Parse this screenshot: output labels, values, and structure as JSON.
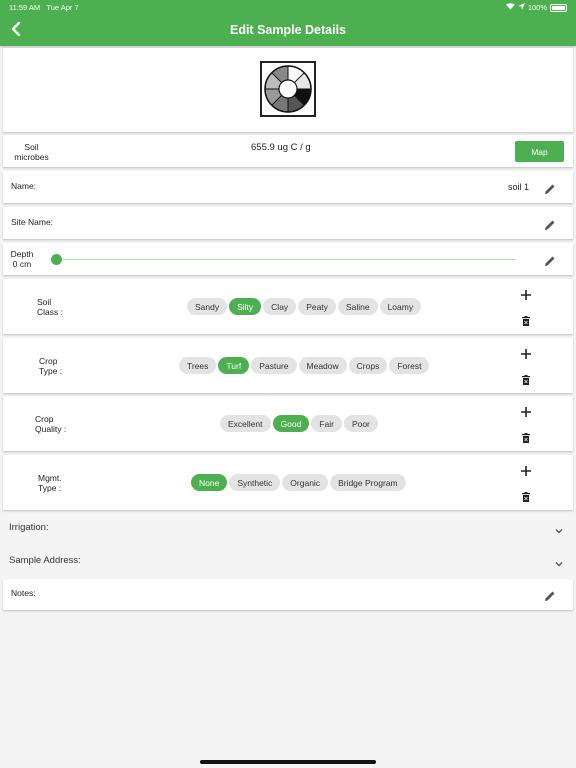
{
  "status_bar": {
    "time": "11:59 AM",
    "date": "Tue Apr 7",
    "battery": "100%"
  },
  "header": {
    "title": "Edit Sample Details",
    "back_icon": "chevron-left-icon"
  },
  "soil": {
    "label_line1": "Soil",
    "label_line2": "microbes",
    "value": "655.9 ug C / g",
    "map_button": "Map"
  },
  "name_field": {
    "label": "Name:",
    "value": "soil 1"
  },
  "site_field": {
    "label": "Site Name:",
    "value": ""
  },
  "depth": {
    "label": "Depth",
    "value_text": "0 cm",
    "slider_fraction": 0
  },
  "soil_class": {
    "label_line1": "Soil",
    "label_line2": "Class :",
    "options": [
      "Sandy",
      "Silty",
      "Clay",
      "Peaty",
      "Saline",
      "Loamy"
    ],
    "selected": "Silty"
  },
  "crop_type": {
    "label_line1": "Crop",
    "label_line2": "Type :",
    "options": [
      "Trees",
      "Turf",
      "Pasture",
      "Meadow",
      "Crops",
      "Forest"
    ],
    "selected": "Turf"
  },
  "crop_quality": {
    "label_line1": "Crop",
    "label_line2": "Quality :",
    "options": [
      "Excellent",
      "Good",
      "Fair",
      "Poor"
    ],
    "selected": "Good"
  },
  "mgmt_type": {
    "label_line1": "Mgmt.",
    "label_line2": "Type :",
    "options": [
      "None",
      "Synthetic",
      "Organic",
      "Bridge Program"
    ],
    "selected": "None"
  },
  "irrigation": {
    "label": "Irrigation:"
  },
  "sample_address": {
    "label": "Sample Address:"
  },
  "notes": {
    "label": "Notes:"
  },
  "colors": {
    "accent": "#4caf50",
    "chip_bg": "#e3e3e3"
  }
}
